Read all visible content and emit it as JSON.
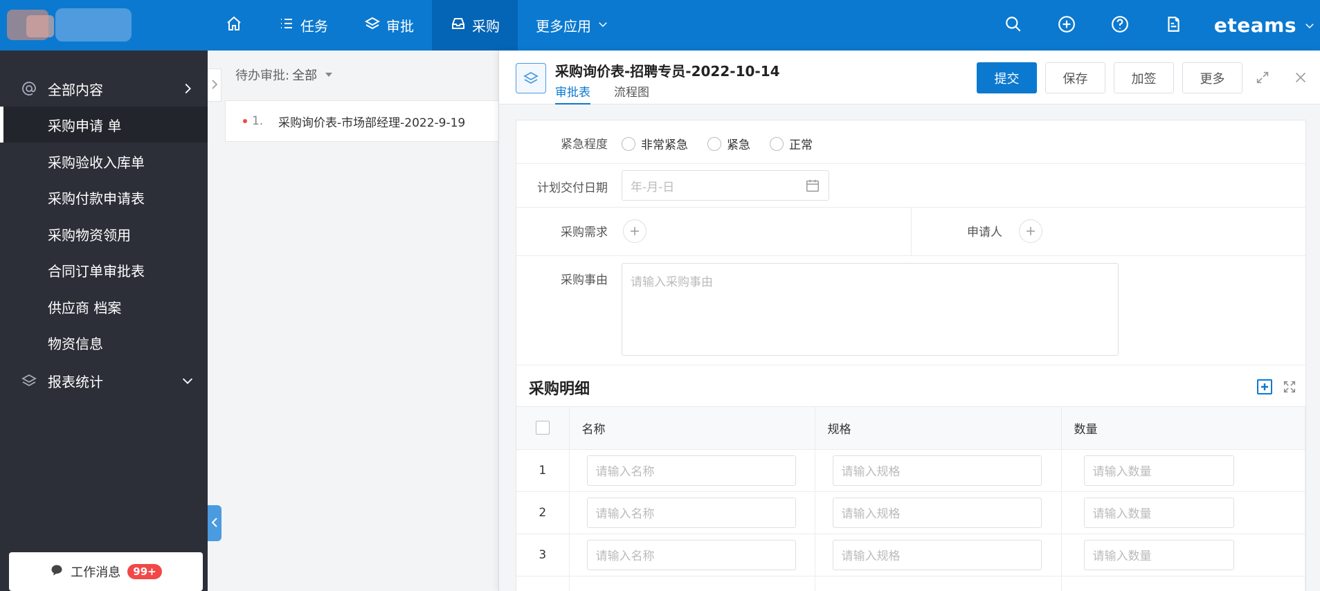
{
  "topbar": {
    "brand": "eteams",
    "nav": [
      {
        "label": "",
        "icon": "home-icon"
      },
      {
        "label": "任务",
        "icon": "list-icon"
      },
      {
        "label": "审批",
        "icon": "layers-icon"
      },
      {
        "label": "采购",
        "icon": "inbox-icon",
        "active": true
      },
      {
        "label": "更多应用",
        "icon": "chevron-down-icon"
      }
    ],
    "accent": "#0b79d0"
  },
  "sidebar": {
    "items": [
      {
        "label": "全部内容",
        "icon": "at-icon"
      },
      {
        "label": "采购申请 单"
      },
      {
        "label": "采购验收入库单"
      },
      {
        "label": "采购付款申请表"
      },
      {
        "label": "采购物资领用"
      },
      {
        "label": "合同订单审批表"
      },
      {
        "label": "供应商 档案"
      },
      {
        "label": "物资信息"
      },
      {
        "label": "报表统计",
        "icon": "layers-icon"
      }
    ],
    "message": {
      "label": "工作消息",
      "badge": "99+"
    }
  },
  "list": {
    "filter_label": "待办审批:",
    "filter_value": "全部",
    "items": [
      {
        "num": "1.",
        "title": "采购询价表-市场部经理-2022-9-19"
      }
    ]
  },
  "detail": {
    "title": "采购询价表-招聘专员-2022-10-14",
    "tabs": [
      "审批表",
      "流程图"
    ],
    "buttons": {
      "submit": "提交",
      "save": "保存",
      "countersign": "加签",
      "more": "更多"
    },
    "form": {
      "urgency_label": "紧急程度",
      "urgency_options": [
        "非常紧急",
        "紧急",
        "正常"
      ],
      "date_label": "计划交付日期",
      "date_placeholder": "年-月-日",
      "demand_label": "采购需求",
      "applicant_label": "申请人",
      "reason_label": "采购事由",
      "reason_placeholder": "请输入采购事由"
    },
    "section": {
      "title": "采购明细",
      "columns": [
        "名称",
        "规格",
        "数量"
      ],
      "rows": [
        {
          "idx": "1",
          "name_ph": "请输入名称",
          "spec_ph": "请输入规格",
          "qty_ph": "请输入数量"
        },
        {
          "idx": "2",
          "name_ph": "请输入名称",
          "spec_ph": "请输入规格",
          "qty_ph": "请输入数量"
        },
        {
          "idx": "3",
          "name_ph": "请输入名称",
          "spec_ph": "请输入规格",
          "qty_ph": "请输入数量"
        }
      ]
    }
  }
}
